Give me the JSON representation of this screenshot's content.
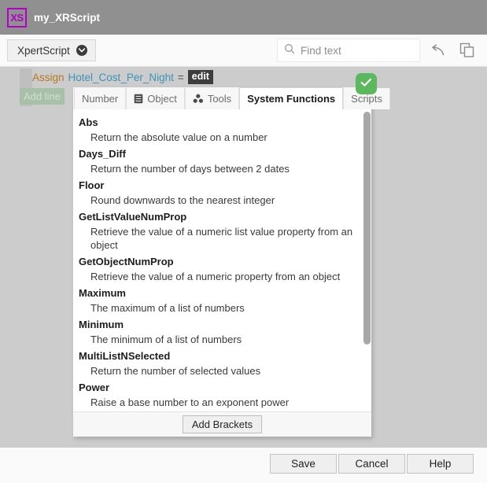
{
  "titlebar": {
    "logo_text": "XS",
    "logo_icon": "xs-logo-icon",
    "title": "my_XRScript",
    "accent": "#b200c8",
    "background": "#909090"
  },
  "toolbar": {
    "script_button_label": "XpertScript",
    "script_button_icon": "chevron-down-icon",
    "search": {
      "placeholder": "Find text",
      "value": "",
      "icon": "search-icon"
    },
    "undo_icon": "undo-arrow-icon",
    "copy_icon": "copy-icon"
  },
  "script": {
    "line": {
      "keyword": "Assign",
      "variable": "Hotel_Cost_Per_Night",
      "operator": "=",
      "badge": "edit",
      "keyword_color": "#b5791f",
      "variable_color": "#3b93b8",
      "badge_bg": "#3d3d3d"
    },
    "add_line_label": "Add line",
    "add_line_color": "#a8bfa8",
    "confirm_icon": "check-icon",
    "confirm_color": "#5cb85c"
  },
  "popup": {
    "tabs": [
      {
        "label": "Number",
        "icon": null,
        "active": false
      },
      {
        "label": "Object",
        "icon": "book-icon",
        "active": false
      },
      {
        "label": "Tools",
        "icon": "tools-icon",
        "active": false
      },
      {
        "label": "System Functions",
        "icon": null,
        "active": true
      },
      {
        "label": "Scripts",
        "icon": null,
        "active": false
      }
    ],
    "functions": [
      {
        "name": "Abs",
        "description": "Return the absolute value on a number"
      },
      {
        "name": "Days_Diff",
        "description": "Return the number of days between 2 dates"
      },
      {
        "name": "Floor",
        "description": "Round downwards to the nearest integer"
      },
      {
        "name": "GetListValueNumProp",
        "description": "Retrieve the value of a numeric list value property from an object"
      },
      {
        "name": "GetObjectNumProp",
        "description": "Retrieve the value of a numeric property from an object"
      },
      {
        "name": "Maximum",
        "description": "The maximum of a list of numbers"
      },
      {
        "name": "Minimum",
        "description": "The minimum of a list of numbers"
      },
      {
        "name": "MultiListNSelected",
        "description": "Return the number of selected values"
      },
      {
        "name": "Power",
        "description": "Raise a base number to an exponent power"
      }
    ],
    "footer_button_label": "Add Brackets",
    "scrollbar": {
      "name": "vertical-scrollbar"
    }
  },
  "bottombar": {
    "save_label": "Save",
    "cancel_label": "Cancel",
    "help_label": "Help"
  }
}
